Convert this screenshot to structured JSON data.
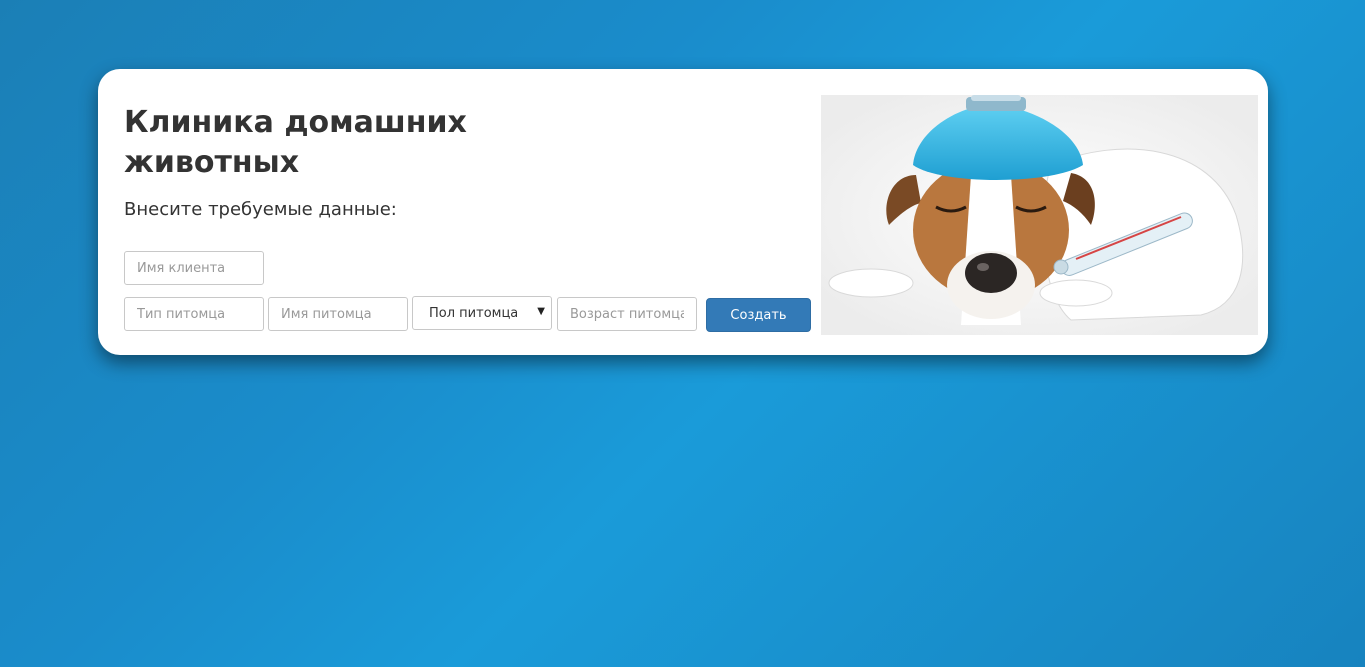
{
  "clinic": {
    "title": "Клиника домашних животных",
    "subtitle": "Внесите требуемые данные:"
  },
  "form": {
    "client_name_placeholder": "Имя клиента",
    "pet_type_placeholder": "Тип питомца",
    "pet_name_placeholder": "Имя питомца",
    "pet_gender_selected": "Пол питомца",
    "pet_age_placeholder": "Возраст питомца",
    "submit_label": "Создать"
  },
  "image": {
    "icon": "sick-dog-illustration"
  },
  "colors": {
    "background": "#1a8ccb",
    "button": "#337ab7",
    "ice_bag": "#3bb8e0"
  }
}
